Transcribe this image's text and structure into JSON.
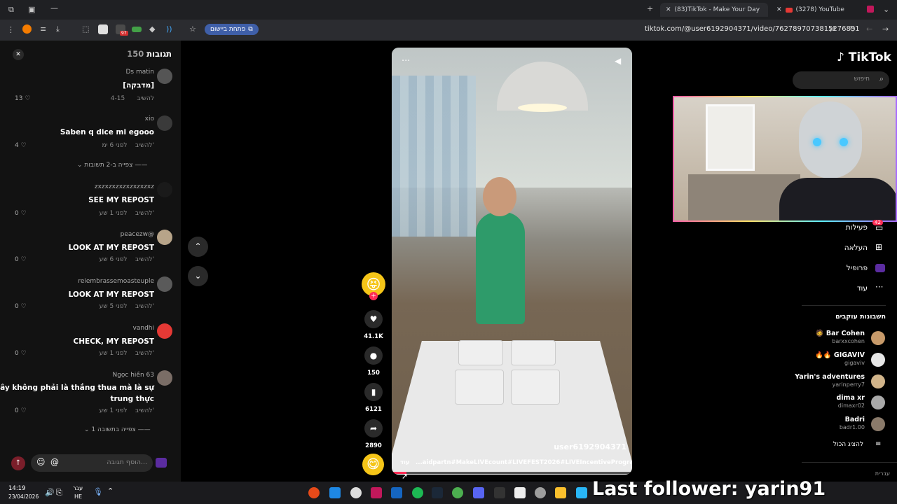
{
  "browser": {
    "tabs": [
      {
        "title": "(83)TikTok - Make Your Day",
        "active": true
      },
      {
        "title": "(3278) YouTube",
        "active": false
      }
    ],
    "url": "tiktok.com/@user6192904371/video/7627897073815276831",
    "apps_button": "פתחת ביישום",
    "ext_badge": "97"
  },
  "comments": {
    "title": "תגובות",
    "count": "150",
    "items": [
      {
        "user": "Ds matin",
        "text": "[מדבקה]",
        "meta": "4-15",
        "reply": "להשיב",
        "likes": "13"
      },
      {
        "user": "xio",
        "text": "Saben q dice mi egooo",
        "meta": "לפני 6 ימ'",
        "reply": "להשיב",
        "likes": "4",
        "more": "צפייה ב-2 תשובות"
      },
      {
        "user": "zxzxzxzxzxzxzxzxz",
        "text": "SEE MY REPOST",
        "meta": "לפני 1 שע'",
        "reply": "להשיב",
        "likes": "0"
      },
      {
        "user": "peacezw@",
        "text": "LOOK AT MY REPOST",
        "meta": "לפני 6 שע'",
        "reply": "להשיב",
        "likes": "0"
      },
      {
        "user": "reiembrassemoasteuple",
        "text": "LOOK AT MY REPOST",
        "meta": "לפני 5 שע'",
        "reply": "להשיב",
        "likes": "0"
      },
      {
        "user": "vandhi",
        "text": "CHECK, MY REPOST",
        "meta": "לפני 1 שע'",
        "reply": "להשיב",
        "likes": "0"
      },
      {
        "user": "Ngọc hiền 63",
        "text": "Ở đây không phải là thắng thua mà là sự",
        "text2": "trung thực",
        "meta": "לפני 1 שע'",
        "reply": "להשיב",
        "likes": "0",
        "more": "צפייה בתשובה 1"
      }
    ],
    "input_placeholder": "הוסף תגובה..."
  },
  "video": {
    "author": "user6192904371",
    "caption": "...aidpartn#MakeLIVEcount#LIVEFEST2026#LIVEIncentiveProgram#",
    "more": "עוד",
    "progress": 0.06
  },
  "actions": {
    "likes": "41.1K",
    "comments": "150",
    "saves": "6121",
    "shares": "2890"
  },
  "sidebar": {
    "logo": "TikTok",
    "search_placeholder": "חיפוש",
    "nav": [
      {
        "label": "פעילות",
        "badge": "42"
      },
      {
        "label": "העלאה"
      },
      {
        "label": "פרופיל"
      },
      {
        "label": "עוד"
      }
    ],
    "following_title": "חשבונות עוקבים",
    "following": [
      {
        "name": "Bar Cohen",
        "handle": "barxxcohen",
        "color": "#c79a6a"
      },
      {
        "name": "GIGAVIV",
        "handle": "gigaviv",
        "color": "#e6e6e6"
      },
      {
        "name": "Yarin's adventures",
        "handle": "yarinperry7",
        "color": "#d1b48a"
      },
      {
        "name": "dima xr",
        "handle": "dimaxr02",
        "color": "#a9a9a9"
      },
      {
        "name": "Badri",
        "handle": "badr1.00",
        "color": "#8a7a6a"
      }
    ],
    "show_all": "להציג הכול",
    "footer": "עברית"
  },
  "overlay": {
    "last_follower": "Last follower: yarin91"
  },
  "taskbar": {
    "time": "14:19",
    "date": "23/04/2026",
    "lang_top": "עבר",
    "lang_bottom": "HE"
  }
}
